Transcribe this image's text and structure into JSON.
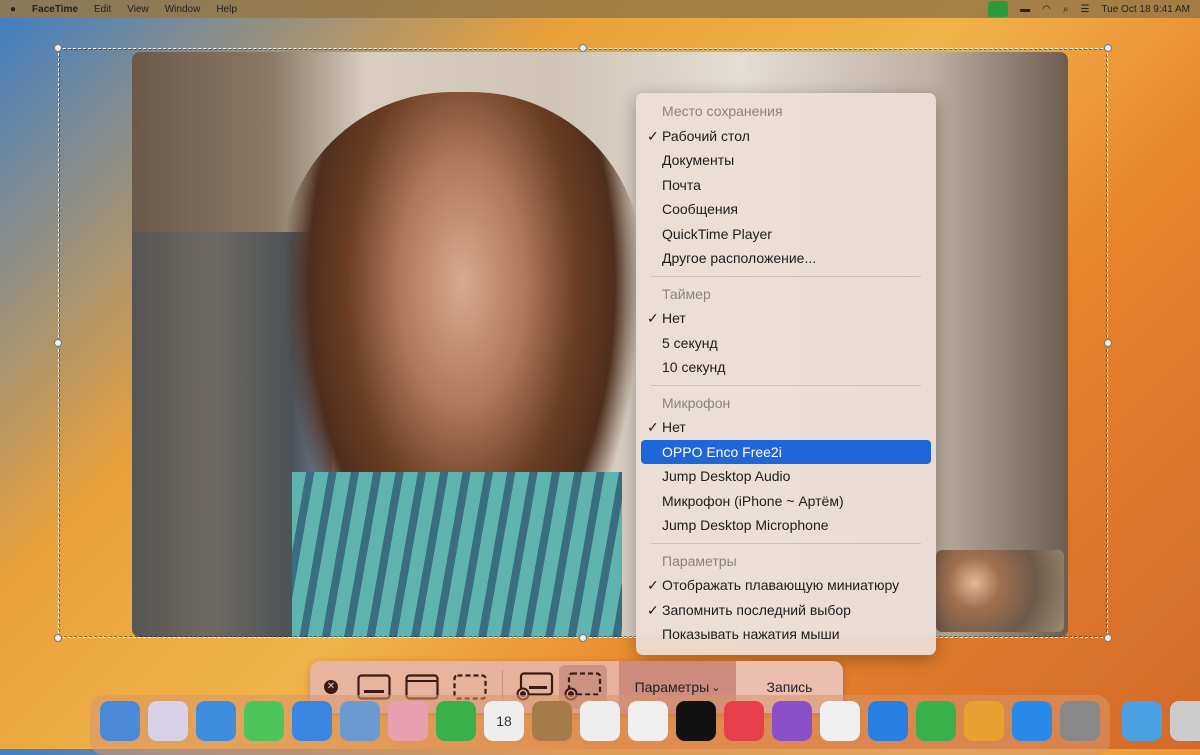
{
  "menubar": {
    "app": "FaceTime",
    "items": [
      "Edit",
      "View",
      "Window",
      "Help"
    ],
    "clock": "Tue Oct 18  9:41 AM"
  },
  "menu": {
    "sections": [
      {
        "header": "Место сохранения",
        "items": [
          {
            "label": "Рабочий стол",
            "checked": true
          },
          {
            "label": "Документы"
          },
          {
            "label": "Почта"
          },
          {
            "label": "Сообщения"
          },
          {
            "label": "QuickTime Player"
          },
          {
            "label": "Другое расположение..."
          }
        ]
      },
      {
        "header": "Таймер",
        "items": [
          {
            "label": "Нет",
            "checked": true
          },
          {
            "label": "5 секунд"
          },
          {
            "label": "10 секунд"
          }
        ]
      },
      {
        "header": "Микрофон",
        "items": [
          {
            "label": "Нет",
            "checked": true
          },
          {
            "label": "OPPO Enco Free2i",
            "selected": true
          },
          {
            "label": "Jump Desktop Audio"
          },
          {
            "label": "Микрофон (iPhone ~ Артём)"
          },
          {
            "label": "Jump Desktop Microphone"
          }
        ]
      },
      {
        "header": "Параметры",
        "items": [
          {
            "label": "Отображать плавающую миниатюру",
            "checked": true
          },
          {
            "label": "Запомнить последний выбор",
            "checked": true
          },
          {
            "label": "Показывать нажатия мыши"
          }
        ]
      }
    ]
  },
  "toolbar": {
    "options_label": "Параметры",
    "record_label": "Запись",
    "chevron": "⌄",
    "close": "✕"
  },
  "dock": {
    "calendar_day": "18"
  }
}
